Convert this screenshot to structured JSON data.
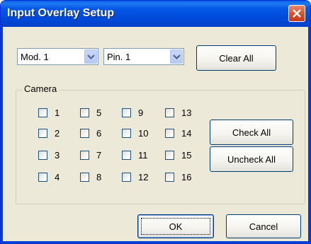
{
  "window": {
    "title": "Input Overlay Setup"
  },
  "module_select": {
    "value": "Mod. 1"
  },
  "pin_select": {
    "value": "Pin. 1"
  },
  "buttons": {
    "clear_all": "Clear All",
    "check_all": "Check All",
    "uncheck_all": "Uncheck All",
    "ok": "OK",
    "cancel": "Cancel"
  },
  "camera_group": {
    "label": "Camera",
    "checkboxes": [
      {
        "label": "1",
        "checked": false
      },
      {
        "label": "5",
        "checked": false
      },
      {
        "label": "9",
        "checked": false
      },
      {
        "label": "13",
        "checked": false
      },
      {
        "label": "2",
        "checked": false
      },
      {
        "label": "6",
        "checked": false
      },
      {
        "label": "10",
        "checked": false
      },
      {
        "label": "14",
        "checked": false
      },
      {
        "label": "3",
        "checked": false
      },
      {
        "label": "7",
        "checked": false
      },
      {
        "label": "11",
        "checked": false
      },
      {
        "label": "15",
        "checked": false
      },
      {
        "label": "4",
        "checked": false
      },
      {
        "label": "8",
        "checked": false
      },
      {
        "label": "12",
        "checked": false
      },
      {
        "label": "16",
        "checked": false
      }
    ]
  }
}
